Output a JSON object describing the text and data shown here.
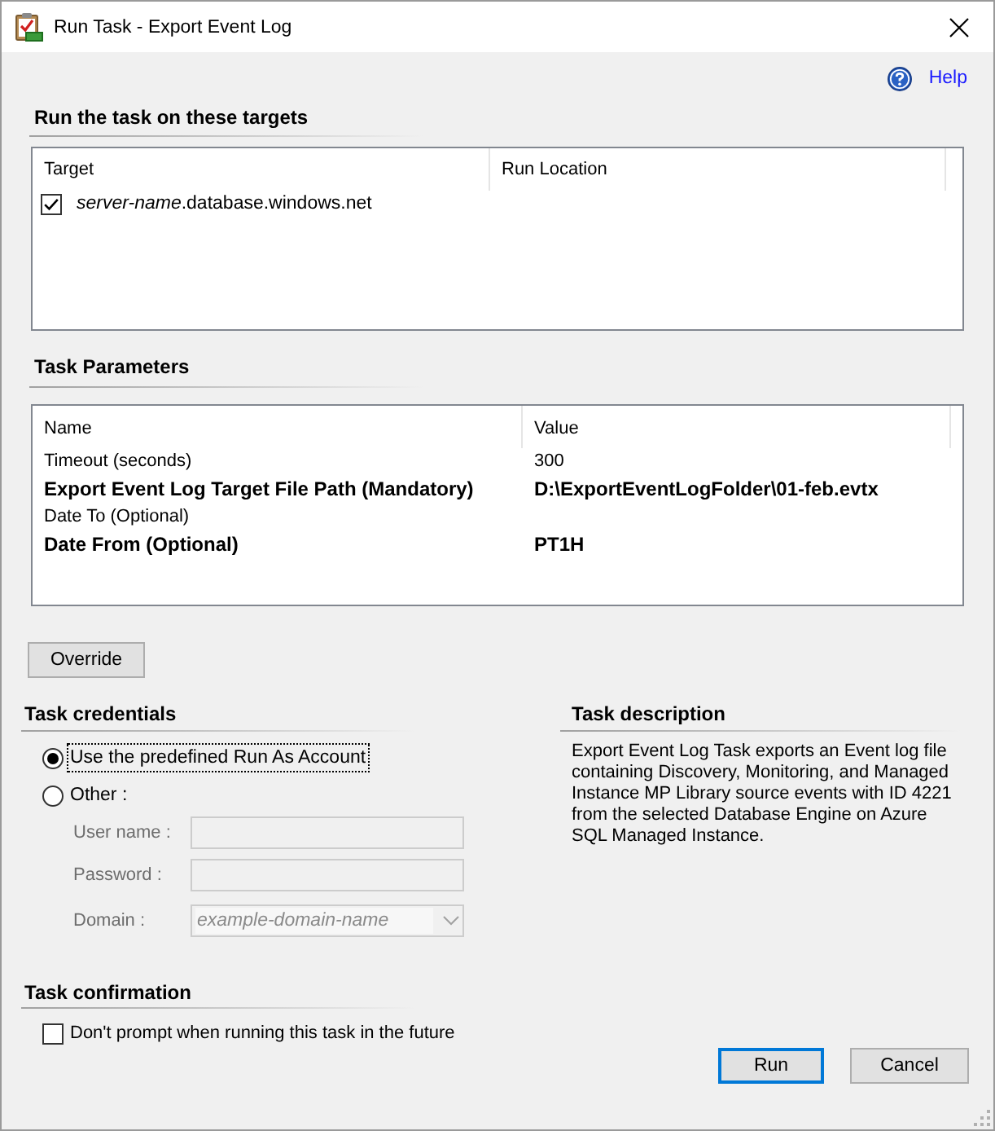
{
  "window": {
    "title": "Run Task - Export Event Log"
  },
  "help": {
    "label": "Help"
  },
  "targets": {
    "title": "Run the task on these targets",
    "columns": [
      "Target",
      "Run Location"
    ],
    "rows": [
      {
        "checked": true,
        "target": "*server-name*.database.windows.net"
      }
    ]
  },
  "parameters": {
    "title": "Task Parameters",
    "columns": [
      "Name",
      "Value"
    ],
    "rows": [
      {
        "name": "Timeout (seconds)",
        "value": "300",
        "overridden": false
      },
      {
        "name": "Export Event Log Target File Path (Mandatory)",
        "value": "D:\\ExportEventLogFolder\\01-feb.evtx",
        "overridden": true
      },
      {
        "name": "Date To (Optional)",
        "overridden": false
      },
      {
        "name": "Date From (Optional)",
        "value": "PT1H",
        "overridden": true
      }
    ]
  },
  "override_button": {
    "label": "Override"
  },
  "credentials": {
    "title": "Task credentials",
    "options": [
      {
        "label": "Use the predefined Run As Account",
        "selected": true,
        "focused": true
      },
      {
        "label": "Other :",
        "selected": false,
        "focused": false
      }
    ],
    "fields": [
      {
        "kind": "text",
        "label": "User name :",
        "disabled": true
      },
      {
        "kind": "password",
        "label": "Password :",
        "disabled": true
      },
      {
        "kind": "dropdown",
        "label": "Domain :",
        "value": "example-domain-name",
        "disabled": true
      }
    ]
  },
  "description": {
    "title": "Task description",
    "text": "Export Event Log Task exports an Event log file containing Discovery, Monitoring, and Managed Instance MP Library source events with ID 4221 from the selected Database Engine on Azure SQL Managed Instance."
  },
  "confirmation": {
    "title": "Task confirmation",
    "checkbox": {
      "label": "Don't prompt when running this task in the future",
      "checked": false
    }
  },
  "buttons": [
    {
      "label": "Run",
      "default": true
    },
    {
      "label": "Cancel",
      "default": false
    }
  ]
}
